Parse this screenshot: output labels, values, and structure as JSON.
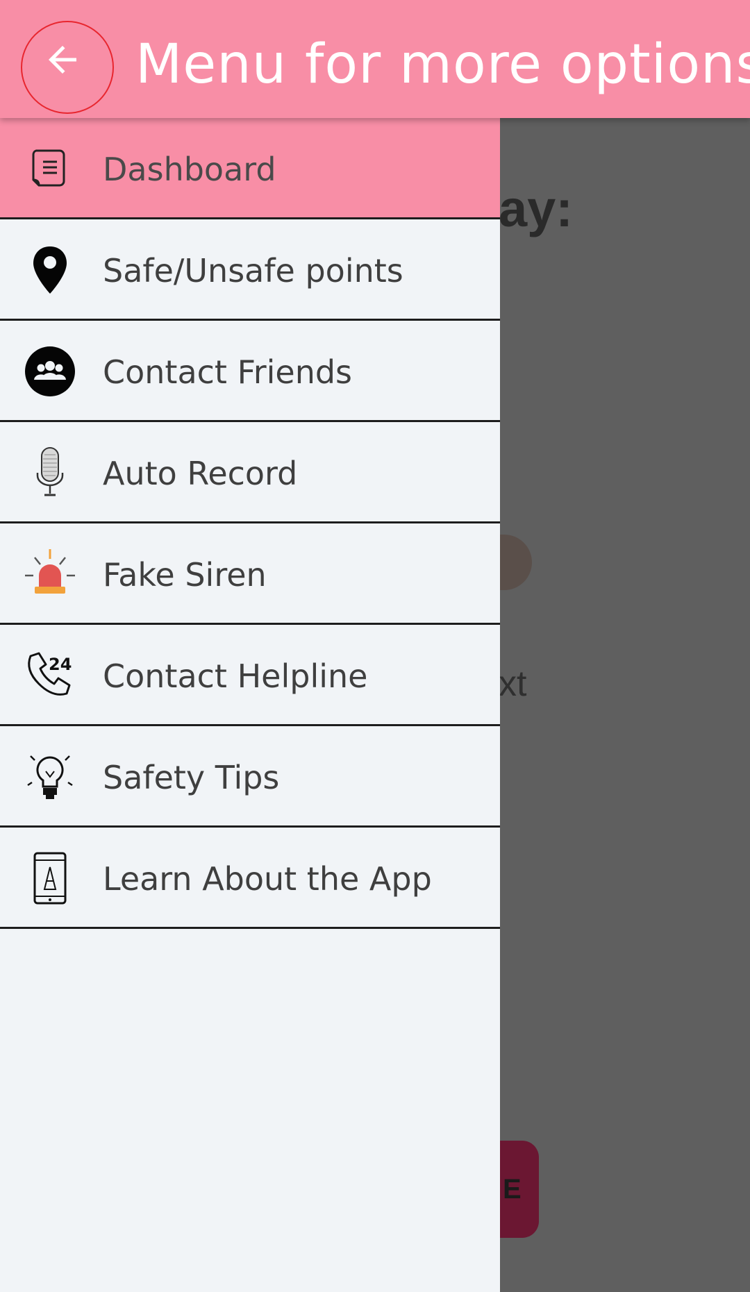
{
  "appbar": {
    "title": "Menu for more options",
    "back_icon": "arrow-left-icon",
    "color": "#f88ea6"
  },
  "drawer": {
    "items": [
      {
        "label": "Dashboard",
        "icon": "document-icon",
        "active": true
      },
      {
        "label": "Safe/Unsafe points",
        "icon": "map-pin-icon",
        "active": false
      },
      {
        "label": "Contact Friends",
        "icon": "group-icon",
        "active": false
      },
      {
        "label": "Auto Record",
        "icon": "microphone-icon",
        "active": false
      },
      {
        "label": "Fake Siren",
        "icon": "siren-icon",
        "active": false
      },
      {
        "label": "Contact Helpline",
        "icon": "phone-24-icon",
        "active": false
      },
      {
        "label": "Safety Tips",
        "icon": "lightbulb-icon",
        "active": false
      },
      {
        "label": "Learn About the App",
        "icon": "mobile-info-icon",
        "active": false
      }
    ]
  },
  "background": {
    "heading_fragment": "ay:",
    "text_fragment": "xt",
    "button_fragment": "E"
  }
}
